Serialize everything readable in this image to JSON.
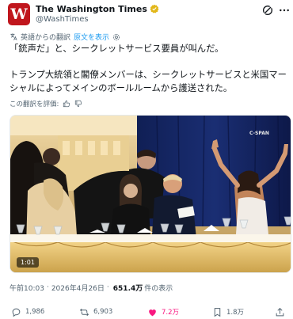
{
  "account": {
    "display_name": "The Washington Times",
    "handle": "@WashTimes",
    "avatar_letter": "W"
  },
  "translation": {
    "note": "英語からの翻訳",
    "show_original": "原文を表示"
  },
  "tweet": {
    "text": "「銃声だ」と、シークレットサービス要員が叫んだ。\n\nトランプ大統領と閣僚メンバーは、シークレットサービスと米国マーシャルによってメインのボールルームから護送された。"
  },
  "rating": {
    "label": "この翻訳を評価:"
  },
  "media": {
    "watermark": "C-SPAN",
    "duration": "1:01"
  },
  "meta": {
    "time": "午前10:03",
    "separator": "·",
    "date": "2026年4月26日",
    "views": "651.4万",
    "views_suffix": "件の表示"
  },
  "actions": {
    "replies": "1,986",
    "reposts": "6,903",
    "likes": "7.2万",
    "bookmarks": "1.8万"
  },
  "colors": {
    "accent": "#1d9bf0",
    "like": "#f91880",
    "brand": "#c0161d"
  }
}
